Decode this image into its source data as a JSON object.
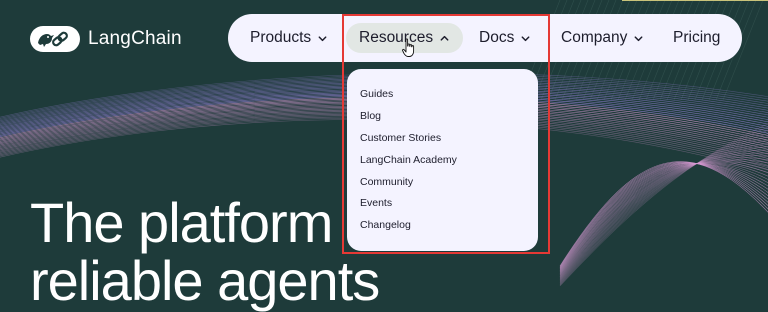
{
  "brand": {
    "name": "LangChain"
  },
  "nav": {
    "items": [
      {
        "label": "Products",
        "has_chevron": true,
        "expanded": false
      },
      {
        "label": "Resources",
        "has_chevron": true,
        "expanded": true
      },
      {
        "label": "Docs",
        "has_chevron": true,
        "expanded": false
      },
      {
        "label": "Company",
        "has_chevron": true,
        "expanded": false
      },
      {
        "label": "Pricing",
        "has_chevron": false,
        "expanded": false
      }
    ]
  },
  "dropdown": {
    "parent": "Resources",
    "items": [
      "Guides",
      "Blog",
      "Customer Stories",
      "LangChain Academy",
      "Community",
      "Events",
      "Changelog"
    ]
  },
  "hero": {
    "line1": "The platform f",
    "line2": "reliable agents"
  },
  "colors": {
    "background": "#1e3b3a",
    "nav_background": "#f4f3ff",
    "active_pill": "#e2e7e4",
    "highlight": "#e53935",
    "wave_purple": "#9d85e0",
    "wave_pink": "#d89ad4"
  },
  "icons": {
    "logo": "parrot-link-icon",
    "chevron_down": "chevron-down-icon",
    "chevron_up": "chevron-up-icon",
    "cursor": "hand-pointer-icon"
  }
}
